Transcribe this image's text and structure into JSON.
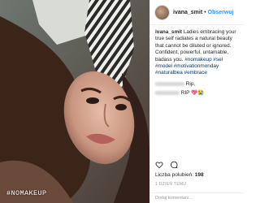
{
  "photo": {
    "caption": "#NOMAKEUP"
  },
  "header": {
    "username": "ivana_smit",
    "separator": "•",
    "follow_label": "Obserwuj"
  },
  "caption": {
    "username": "ivana_smit",
    "text": "Ladies embracing your true self radiates a natural beauty that cannot be diluted or ignored. Confident, powerful, untamable, badass you.",
    "hashtags_line1": "#nomakeup #sel",
    "hashtags_line2": "#model #motivationmonday #naturalbea",
    "hashtags_line3": "#embrace"
  },
  "comments": [
    {
      "text": "Rip,"
    },
    {
      "text": "RIP 💖😭"
    }
  ],
  "likes": {
    "label": "Liczba polubień:",
    "count": "198"
  },
  "time": "1 DZIEŃ TEMU",
  "add_comment_placeholder": "Dodaj komentarz..."
}
